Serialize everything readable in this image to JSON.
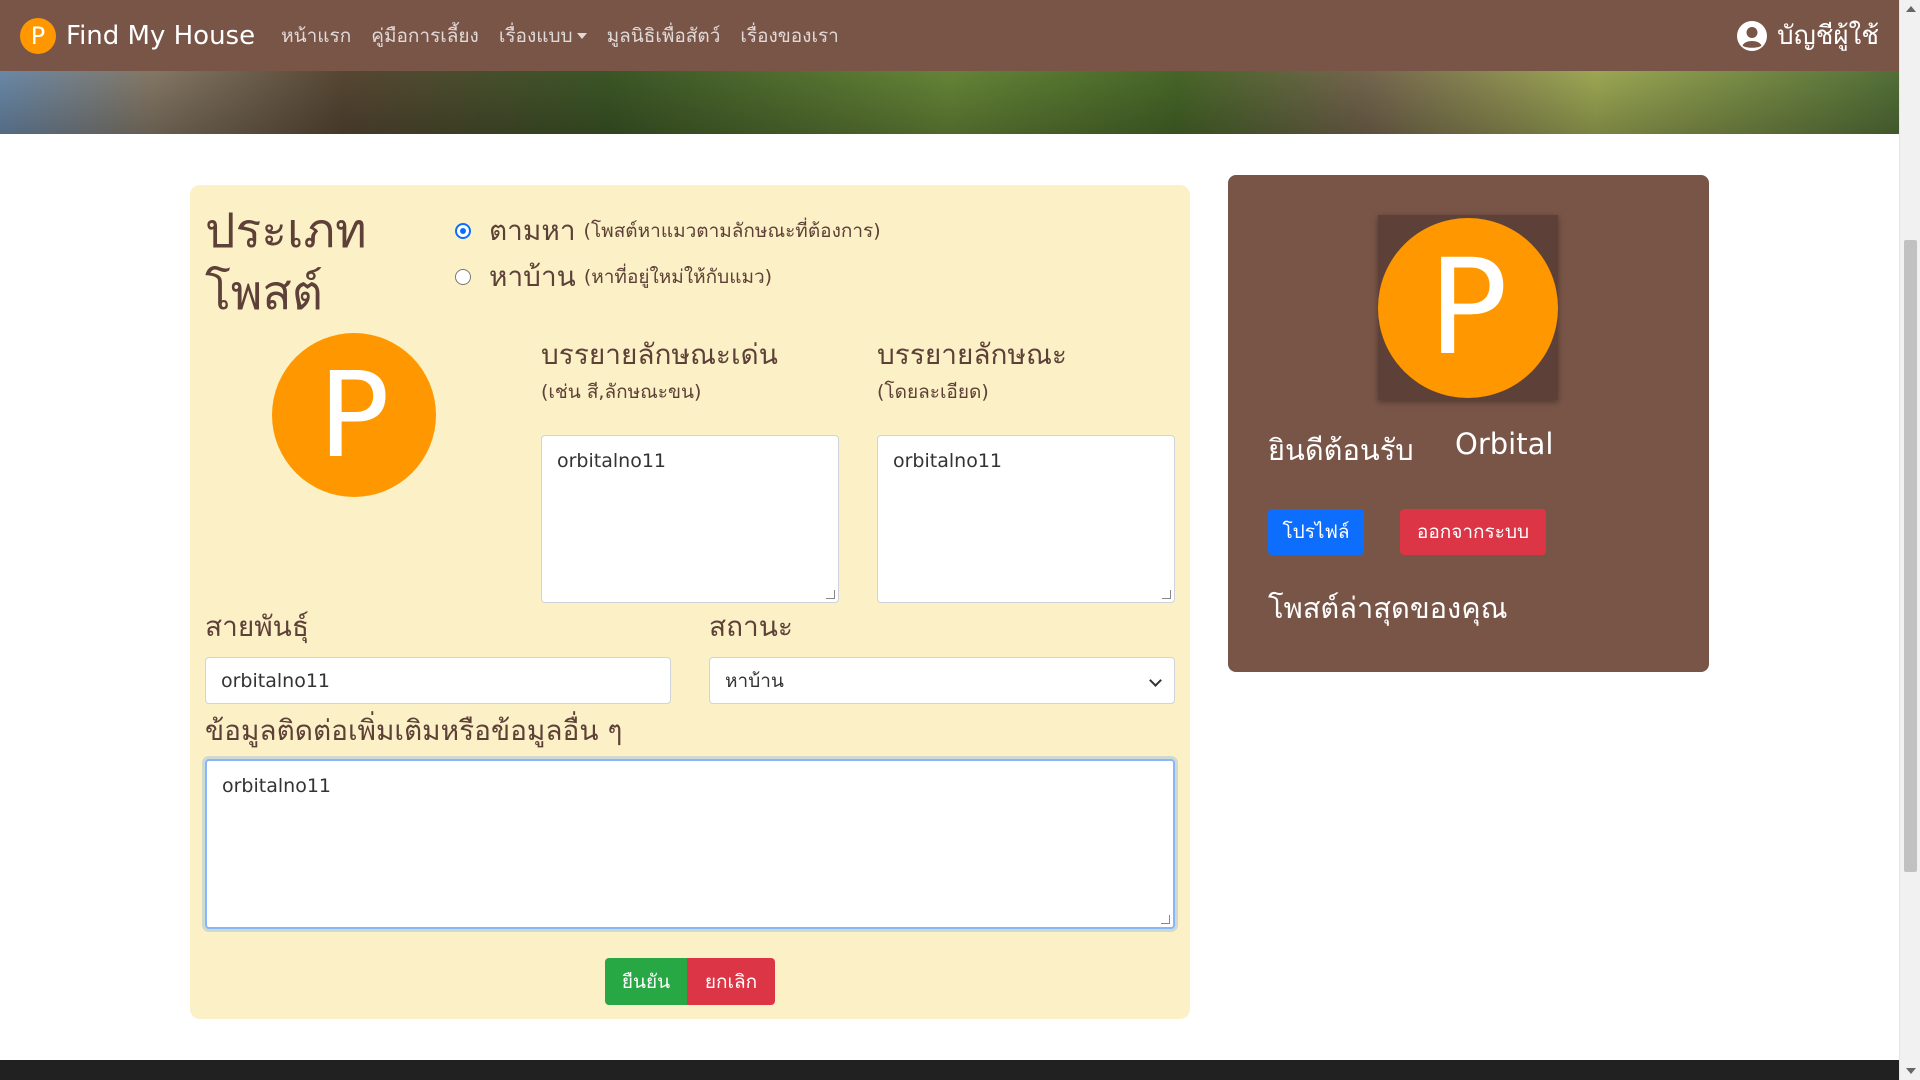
{
  "navbar": {
    "brand_logo_letter": "P",
    "brand": "Find My House",
    "links": [
      "หน้าแรก",
      "คู่มือการเลี้ยง",
      "เรื่องแบบ",
      "มูลนิธิเพื่อสัตว์",
      "เรื่องของเรา"
    ],
    "account": "บัญชีผู้ใช้"
  },
  "form": {
    "post_type_label_line1": "ประเภท",
    "post_type_label_line2": "โพสต์",
    "options": [
      {
        "label": "ตามหา",
        "hint": "(โพสต์หาแมวตามลักษณะที่ต้องการ)",
        "checked": true
      },
      {
        "label": "หาบ้าน",
        "hint": "(หาที่อยู่ใหม่ให้กับแมว)",
        "checked": false
      }
    ],
    "avatar_letter": "P",
    "highlight": {
      "title": "บรรยายลักษณะเด่น",
      "subtitle": "(เช่น สี,ลักษณะขน)",
      "value": "orbitalno11"
    },
    "detail": {
      "title": "บรรยายลักษณะ",
      "subtitle": "(โดยละเอียด)",
      "value": "orbitalno11"
    },
    "breed": {
      "label": "สายพันธุ์",
      "value": "orbitalno11"
    },
    "status": {
      "label": "สถานะ",
      "selected": "หาบ้าน"
    },
    "contact": {
      "label": "ข้อมูลติดต่อเพิ่มเติมหรือข้อมูลอื่น ๆ",
      "value": "orbitalno11"
    },
    "confirm_label": "ยืนยัน",
    "cancel_label": "ยกเลิก"
  },
  "profile": {
    "avatar_letter": "P",
    "welcome": "ยินดีต้อนรับ",
    "username": "Orbital",
    "profile_button": "โปรไฟล์",
    "logout_button": "ออกจากระบบ",
    "latest_posts": "โพสต์ล่าสุดของคุณ"
  },
  "colors": {
    "navbar": "#795548",
    "brand_orange": "#ff9800",
    "form_bg": "#fcf1c6",
    "confirm": "#28a745",
    "cancel": "#dc3545",
    "primary": "#0d6efd"
  }
}
